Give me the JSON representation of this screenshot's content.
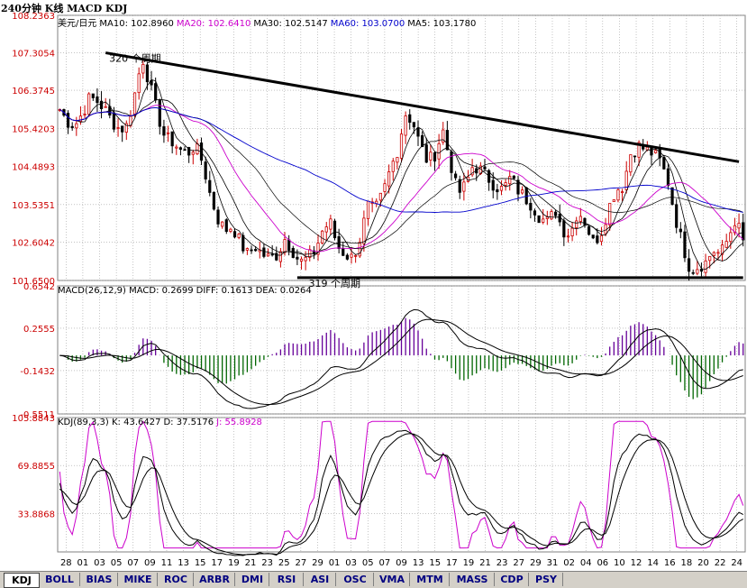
{
  "title": "240分钟 K线 MACD KDJ",
  "panels": {
    "price": {
      "header": [
        {
          "text": "美元/日元",
          "color": "#000000"
        },
        {
          "text": "MA10: 102.8960",
          "color": "#000000"
        },
        {
          "text": "MA20: 102.6410",
          "color": "#cc00cc"
        },
        {
          "text": "MA30: 102.5147",
          "color": "#000000"
        },
        {
          "text": "MA60: 103.0700",
          "color": "#0000cc"
        },
        {
          "text": "MA5: 103.1780",
          "color": "#000000"
        }
      ],
      "annotations": [
        "320 个周期",
        "319 个周期"
      ]
    },
    "macd": {
      "header": [
        {
          "text": "MACD(26,12,9) MACD: 0.2699",
          "color": "#000000"
        },
        {
          "text": "DIFF: 0.1613",
          "color": "#000000"
        },
        {
          "text": "DEA: 0.0264",
          "color": "#000000"
        }
      ]
    },
    "kdj": {
      "header": [
        {
          "text": "KDJ(89,3,3) K: 43.6427",
          "color": "#000000"
        },
        {
          "text": "D: 37.5176",
          "color": "#000000"
        },
        {
          "text": "J: 55.8928",
          "color": "#cc00cc"
        }
      ]
    }
  },
  "tabs": [
    "KDJ",
    "BOLL",
    "BIAS",
    "MIKE",
    "ROC",
    "ARBR",
    "DMI",
    "RSI",
    "ASI",
    "OSC",
    "VMA",
    "MTM",
    "MASS",
    "CDP",
    "PSY"
  ],
  "active_tab": "KDJ",
  "colors": {
    "up": "#cc0000",
    "down": "#000000",
    "macd_pos": "#660099",
    "macd_neg": "#006600",
    "ma_blue": "#0000cc",
    "ma_pink": "#cc00cc",
    "axis_label": "#cc0000"
  },
  "chart_data": [
    {
      "type": "candlestick",
      "name": "price",
      "ylim": [
        101.65,
        108.2363
      ],
      "yticks": [
        108.2363,
        107.3054,
        106.3745,
        105.4203,
        104.4893,
        103.5351,
        102.6042,
        101.65
      ],
      "xticks": [
        "28",
        "01",
        "03",
        "05",
        "07",
        "09",
        "11",
        "13",
        "15",
        "17",
        "19",
        "21",
        "23",
        "25",
        "27",
        "29",
        "01",
        "03",
        "05",
        "07",
        "09",
        "13",
        "15",
        "17",
        "19",
        "21",
        "23",
        "27",
        "29",
        "31",
        "02",
        "04",
        "06",
        "10",
        "12",
        "14",
        "16",
        "18",
        "20",
        "22",
        "24"
      ],
      "n_bars": 165,
      "anchor_close": [
        105.9,
        105.6,
        105.5,
        105.8,
        106.2,
        106.1,
        105.9,
        105.6,
        105.4,
        105.5,
        106.3,
        107.2,
        106.5,
        105.8,
        105.2,
        105.1,
        104.9,
        104.8,
        105.0,
        104.6,
        103.8,
        103.2,
        102.9,
        103.0,
        102.6,
        102.3,
        102.5,
        102.3,
        102.2,
        102.3,
        102.7,
        102.4,
        102.1,
        102.2,
        102.4,
        102.9,
        103.1,
        102.5,
        102.3,
        102.2,
        102.7,
        103.5,
        103.4,
        103.8,
        104.4,
        104.9,
        105.8,
        105.6,
        105.0,
        104.6,
        104.8,
        105.4,
        104.6,
        103.8,
        104.0,
        104.5,
        104.4,
        104.2,
        104.0,
        103.9,
        104.2,
        103.9,
        103.7,
        103.5,
        103.2,
        103.1,
        103.4,
        102.9,
        102.8,
        103.4,
        103.1,
        102.6,
        102.8,
        103.4,
        103.9,
        104.0,
        104.8,
        105.0,
        104.9,
        104.8,
        104.6,
        104.1,
        103.2,
        102.5,
        101.9,
        102.0,
        102.1,
        102.4,
        102.3,
        102.7,
        103.2,
        102.6
      ],
      "trendlines": [
        {
          "from": [
            11,
            107.3054
          ],
          "to": [
            163,
            104.6
          ]
        },
        {
          "from": [
            57,
            101.72
          ],
          "to": [
            164,
            101.72
          ]
        }
      ]
    },
    {
      "type": "bar+line",
      "name": "MACD",
      "ylim": [
        -0.5511,
        0.6542
      ],
      "yticks": [
        0.6542,
        0.2555,
        -0.1432,
        -0.5511
      ],
      "series": [
        {
          "name": "MACD"
        },
        {
          "name": "DIFF"
        },
        {
          "name": "DEA"
        }
      ]
    },
    {
      "type": "line",
      "name": "KDJ",
      "ylim": [
        5,
        105.8843
      ],
      "yticks": [
        105.8843,
        69.8855,
        33.8868
      ],
      "series": [
        {
          "name": "K"
        },
        {
          "name": "D"
        },
        {
          "name": "J"
        }
      ]
    }
  ]
}
